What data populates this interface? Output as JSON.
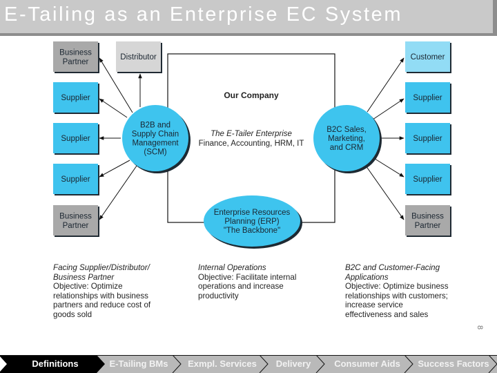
{
  "slide": {
    "title": "E-Tailing as an Enterprise EC System",
    "page_number": "8"
  },
  "diagram": {
    "company_label": "Our Company",
    "enterprise_title": "The E-Tailer Enterprise",
    "enterprise_functions": "Finance, Accounting, HRM, IT",
    "scm_hub": [
      "B2B and",
      "Supply Chain",
      "Management",
      "(SCM)"
    ],
    "b2c_hub": [
      "B2C Sales,",
      "Marketing,",
      "and CRM"
    ],
    "erp_hub": [
      "Enterprise Resources",
      "Planning (ERP)",
      "\"The Backbone\""
    ],
    "left_nodes": [
      {
        "label": [
          "Business",
          "Partner"
        ],
        "kind": "partner"
      },
      {
        "label": [
          "Supplier"
        ],
        "kind": "supplier"
      },
      {
        "label": [
          "Supplier"
        ],
        "kind": "supplier"
      },
      {
        "label": [
          "Supplier"
        ],
        "kind": "supplier"
      },
      {
        "label": [
          "Business",
          "Partner"
        ],
        "kind": "partner"
      }
    ],
    "top_node": {
      "label": [
        "Distributor"
      ],
      "kind": "distributor"
    },
    "right_nodes": [
      {
        "label": [
          "Customer"
        ],
        "kind": "customer"
      },
      {
        "label": [
          "Supplier"
        ],
        "kind": "supplier"
      },
      {
        "label": [
          "Supplier"
        ],
        "kind": "supplier"
      },
      {
        "label": [
          "Supplier"
        ],
        "kind": "supplier"
      },
      {
        "label": [
          "Business",
          "Partner"
        ],
        "kind": "partner"
      }
    ],
    "colors": {
      "supplier": "#3fc3ee",
      "customer": "#92dcf5",
      "partner": "#a9a9a9",
      "distributor": "#d6d6d6",
      "hub": "#3ec4ee",
      "shadow": "#1d2a33"
    }
  },
  "captions": {
    "left": {
      "heading": [
        "Facing Supplier/Distributor/",
        "Business Partner"
      ],
      "body": [
        "Objective: Optimize",
        "relationships with business",
        "partners and reduce cost of",
        "goods sold"
      ]
    },
    "center": {
      "heading": [
        "Internal Operations"
      ],
      "body": [
        "Objective: Facilitate internal",
        "operations and increase",
        "productivity"
      ]
    },
    "right": {
      "heading": [
        "B2C and Customer-Facing",
        "Applications"
      ],
      "body": [
        "Objective: Optimize business",
        "relationships with customers;",
        "increase service",
        "effectiveness and sales"
      ]
    }
  },
  "nav": {
    "items": [
      {
        "label": "Definitions",
        "active": true
      },
      {
        "label": "E-Tailing BMs",
        "active": false
      },
      {
        "label": "Exmpl. Services",
        "active": false
      },
      {
        "label": "Delivery",
        "active": false
      },
      {
        "label": "Consumer Aids",
        "active": false
      },
      {
        "label": "Success Factors",
        "active": false
      }
    ]
  }
}
